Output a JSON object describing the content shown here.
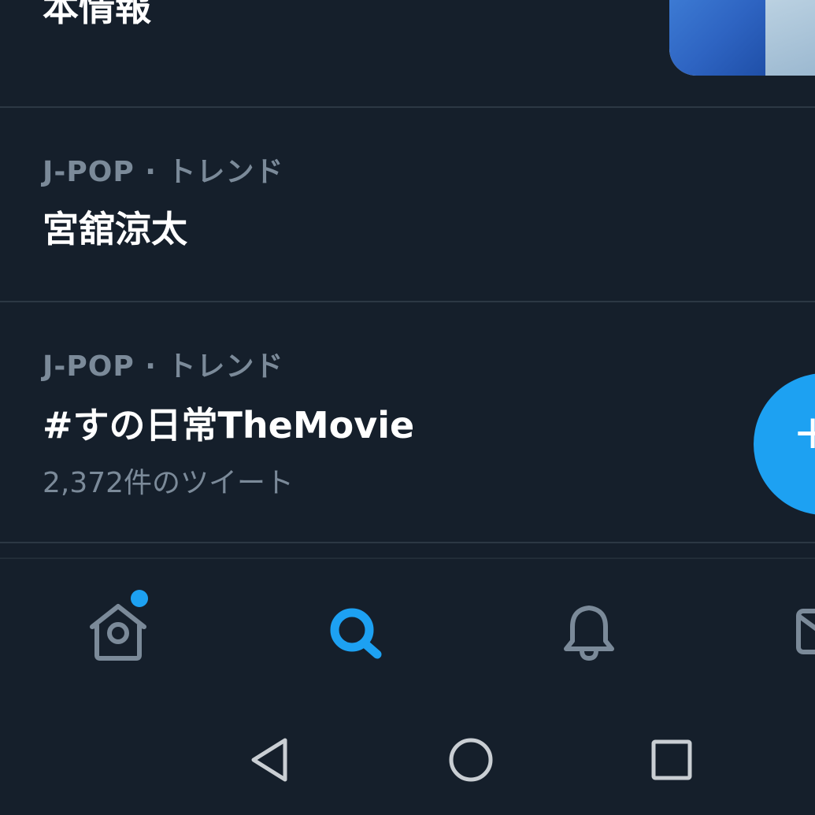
{
  "trends": [
    {
      "title": "本情報"
    },
    {
      "meta": "J-POP · トレンド",
      "title": "宮舘涼太"
    },
    {
      "meta": "J-POP · トレンド",
      "title": "#すの日常TheMovie",
      "count": "2,372件のツイート"
    }
  ],
  "fab": {
    "label": "+"
  },
  "bottom_nav": [
    {
      "icon": "home-icon",
      "badge": true
    },
    {
      "icon": "search-icon",
      "active": true
    },
    {
      "icon": "bell-icon"
    },
    {
      "icon": "mail-icon"
    }
  ],
  "system_nav": [
    "back-icon",
    "home-circle-icon",
    "recent-apps-icon"
  ],
  "colors": {
    "background": "#151f2b",
    "accent": "#1da1f2",
    "muted_text": "#7b8a99",
    "divider": "#2c3844"
  }
}
